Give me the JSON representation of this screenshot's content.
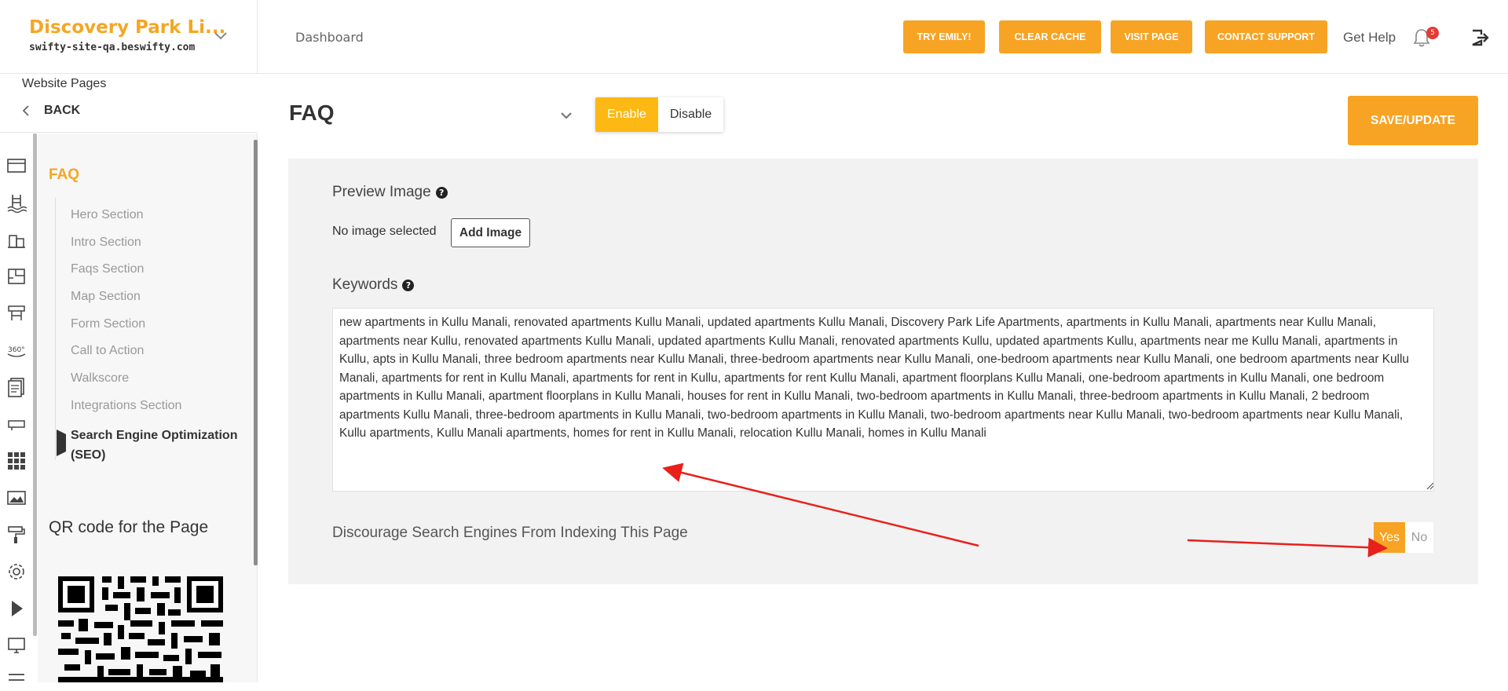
{
  "brand": {
    "site_name": "Discovery Park Li...",
    "domain": "swifty-site-qa.beswifty.com"
  },
  "header": {
    "breadcrumb": "Dashboard",
    "buttons": [
      "TRY EMILY!",
      "CLEAR CACHE",
      "VISIT PAGE",
      "CONTACT SUPPORT"
    ],
    "get_help": "Get Help",
    "notification_count": "5",
    "accent_color": "#f7a324"
  },
  "sidebar": {
    "section_label": "Website Pages",
    "back_label": "BACK",
    "rail_icons": [
      "browser-window-icon",
      "pool-icon",
      "buildings-icon",
      "floorplan-icon",
      "amenities-icon",
      "360-view-icon",
      "documents-icon",
      "keycard-icon",
      "grid-icon",
      "image-icon",
      "paint-roller-icon",
      "gear-icon",
      "play-icon",
      "monitor-icon"
    ],
    "page_title": "FAQ",
    "items": [
      "Hero Section",
      "Intro Section",
      "Faqs Section",
      "Map Section",
      "Form Section",
      "Call to Action",
      "Walkscore",
      "Integrations Section"
    ],
    "active_item": "Search Engine Optimization (SEO)",
    "qr_title": "QR code for the Page"
  },
  "main": {
    "page_title": "FAQ",
    "enable_label": "Enable",
    "disable_label": "Disable",
    "enabled": true,
    "save_label": "SAVE/UPDATE",
    "preview_image_label": "Preview Image",
    "no_image_text": "No image selected",
    "add_image_label": "Add Image",
    "keywords_label": "Keywords",
    "keywords_value": "new apartments in Kullu Manali, renovated apartments Kullu Manali, updated apartments Kullu Manali, Discovery Park Life Apartments, apartments in Kullu Manali, apartments near Kullu Manali, apartments near Kullu, renovated apartments Kullu Manali, updated apartments Kullu Manali, renovated apartments Kullu, updated apartments Kullu, apartments near me Kullu Manali, apartments in Kullu, apts in Kullu Manali, three bedroom apartments near Kullu Manali, three-bedroom apartments near Kullu Manali, one-bedroom apartments near Kullu Manali, one bedroom apartments near Kullu Manali, apartments for rent in Kullu Manali, apartments for rent in Kullu, apartments for rent Kullu Manali, apartment floorplans Kullu Manali, one-bedroom apartments in Kullu Manali, one bedroom apartments in Kullu Manali, apartment floorplans in Kullu Manali, houses for rent in Kullu Manali, two-bedroom apartments in Kullu Manali, three-bedroom apartments in Kullu Manali, 2 bedroom apartments Kullu Manali, three-bedroom apartments in Kullu Manali, two-bedroom apartments in Kullu Manali, two-bedroom apartments near Kullu Manali, two-bedroom apartments near Kullu Manali, Kullu apartments, Kullu Manali apartments, homes for rent in Kullu Manali, relocation Kullu Manali, homes in Kullu Manali",
    "discourage_label": "Discourage Search Engines From Indexing This Page",
    "yes_label": "Yes",
    "no_label": "No",
    "discourage_selected": "Yes"
  }
}
